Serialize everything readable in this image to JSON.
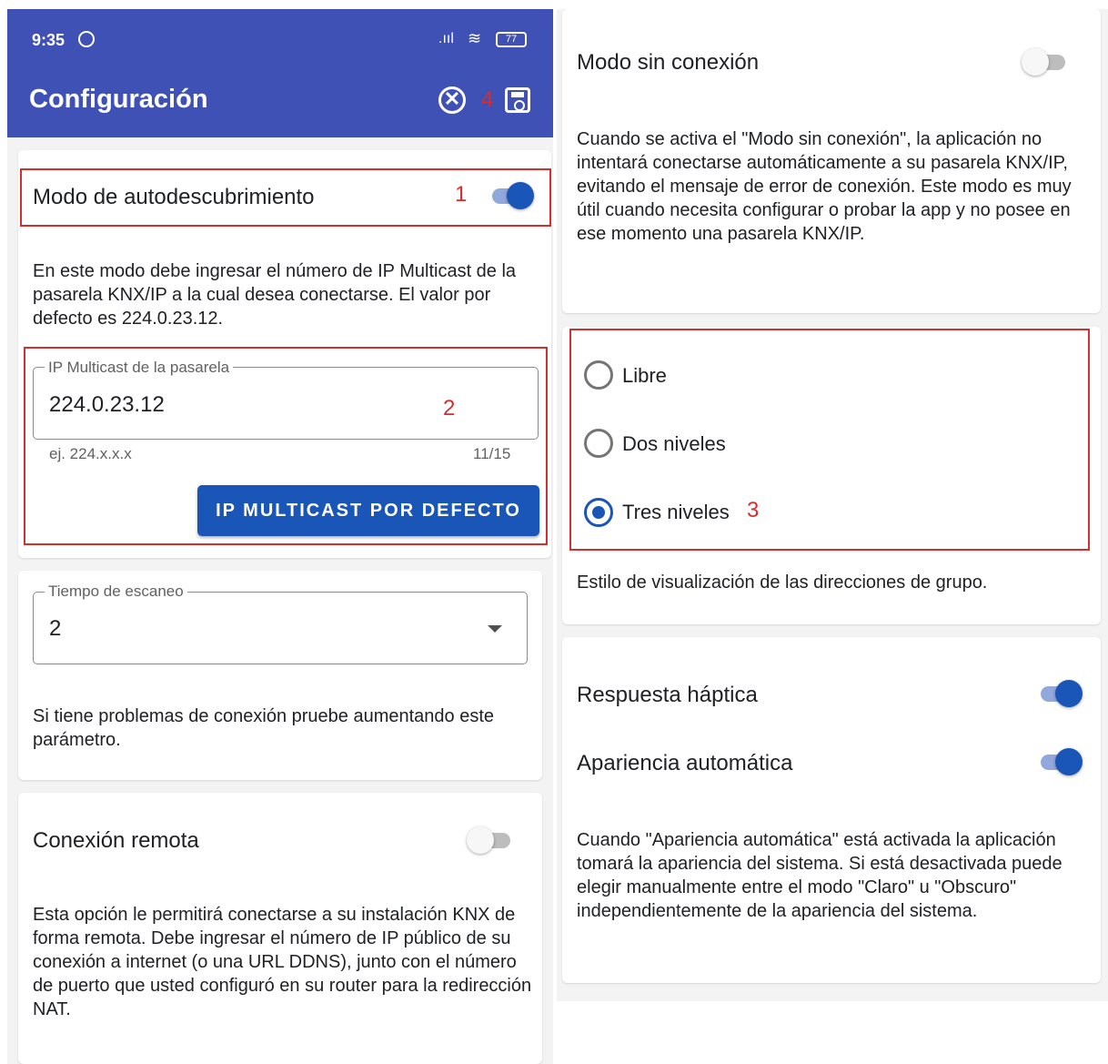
{
  "status_bar": {
    "time": "9:35",
    "signal": ".ııl",
    "wifi": "≋",
    "battery": "77"
  },
  "app_bar": {
    "title": "Configuración",
    "close_icon": "close-circle-icon",
    "save_icon": "save-icon",
    "close_glyph": "✕"
  },
  "annotations": {
    "n1": "1",
    "n2": "2",
    "n3": "3",
    "n4": "4"
  },
  "colors": {
    "primary": "#3f51b5",
    "accent": "#1a56b7",
    "annotation": "#d32f2f"
  },
  "autodiscovery": {
    "label": "Modo de autodescubrimiento",
    "enabled": true,
    "description": "En este modo debe ingresar el número de IP Multicast de la pasarela KNX/IP a la cual desea conectarse. El valor por defecto es 224.0.23.12.",
    "field_label": "IP Multicast de la pasarela",
    "field_value": "224.0.23.12",
    "helper": "ej. 224.x.x.x",
    "counter": "11/15",
    "button": "IP MULTICAST POR DEFECTO"
  },
  "scan_time": {
    "field_label": "Tiempo de escaneo",
    "value": "2",
    "description": "Si tiene problemas de conexión pruebe aumentando este parámetro."
  },
  "remote": {
    "label": "Conexión remota",
    "enabled": false,
    "description": "Esta opción le permitirá conectarse a su instalación KNX de forma remota. Debe ingresar el número de IP público de su conexión a internet (o una URL DDNS), junto con el número de puerto que usted configuró en su router para la redirección NAT."
  },
  "offline": {
    "label": "Modo sin conexión",
    "enabled": false,
    "description": "Cuando se activa el \"Modo sin conexión\", la aplicación no intentará conectarse automáticamente a su pasarela KNX/IP, evitando el mensaje de error de conexión. Este modo es muy útil cuando necesita configurar o probar la app y no posee en ese momento una pasarela KNX/IP."
  },
  "group_style": {
    "options": [
      "Libre",
      "Dos niveles",
      "Tres niveles"
    ],
    "selected": "Tres niveles",
    "description": "Estilo de visualización de las direcciones de grupo."
  },
  "haptic": {
    "label": "Respuesta háptica",
    "enabled": true
  },
  "auto_appearance": {
    "label": "Apariencia automática",
    "enabled": true,
    "description": "Cuando \"Apariencia automática\" está activada la aplicación tomará la apariencia del sistema. Si está desactivada puede elegir manualmente entre el modo \"Claro\" u \"Obscuro\" independientemente de la apariencia del sistema."
  }
}
